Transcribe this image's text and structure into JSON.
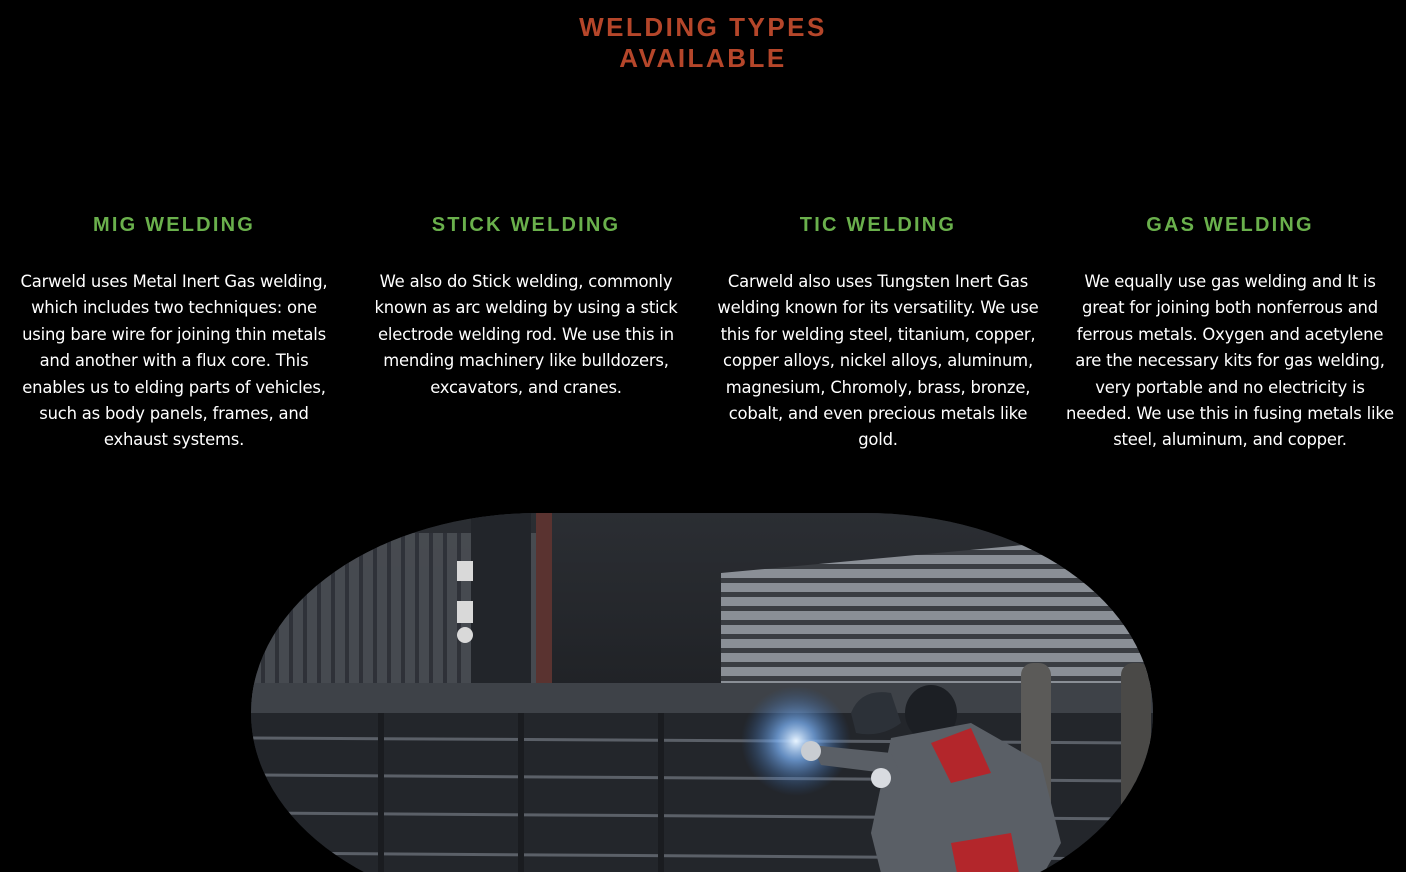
{
  "section": {
    "title_line1": "WELDING TYPES",
    "title_line2": "AVAILABLE"
  },
  "colors": {
    "title": "#b5462a",
    "heading": "#6ab04c",
    "background": "#000000",
    "body_text": "#ffffff"
  },
  "types": [
    {
      "heading": "MIG WELDING",
      "text": "Carweld uses Metal Inert Gas welding, which includes two techniques: one using bare wire for joining thin metals and another with a flux core. This enables us to elding parts of vehicles, such as body panels, frames, and exhaust systems."
    },
    {
      "heading": "STICK WELDING",
      "text": "We also do Stick welding, commonly known as arc welding by using a stick electrode welding rod. We use this in mending machinery like bulldozers, excavators, and cranes."
    },
    {
      "heading": "TIC WELDING",
      "text": "Carweld also uses Tungsten Inert Gas welding known for its versatility. We use this for welding steel, titanium, copper, copper alloys, nickel alloys, aluminum, magnesium, Chromoly, brass, bronze, cobalt, and even precious metals like gold."
    },
    {
      "heading": "GAS WELDING",
      "text": "We equally use gas welding and It is great for joining both nonferrous and ferrous metals. Oxygen and acetylene are the necessary kits for gas welding, very portable and no electricity is needed. We use this in fusing metals like steel, aluminum, and copper."
    }
  ]
}
